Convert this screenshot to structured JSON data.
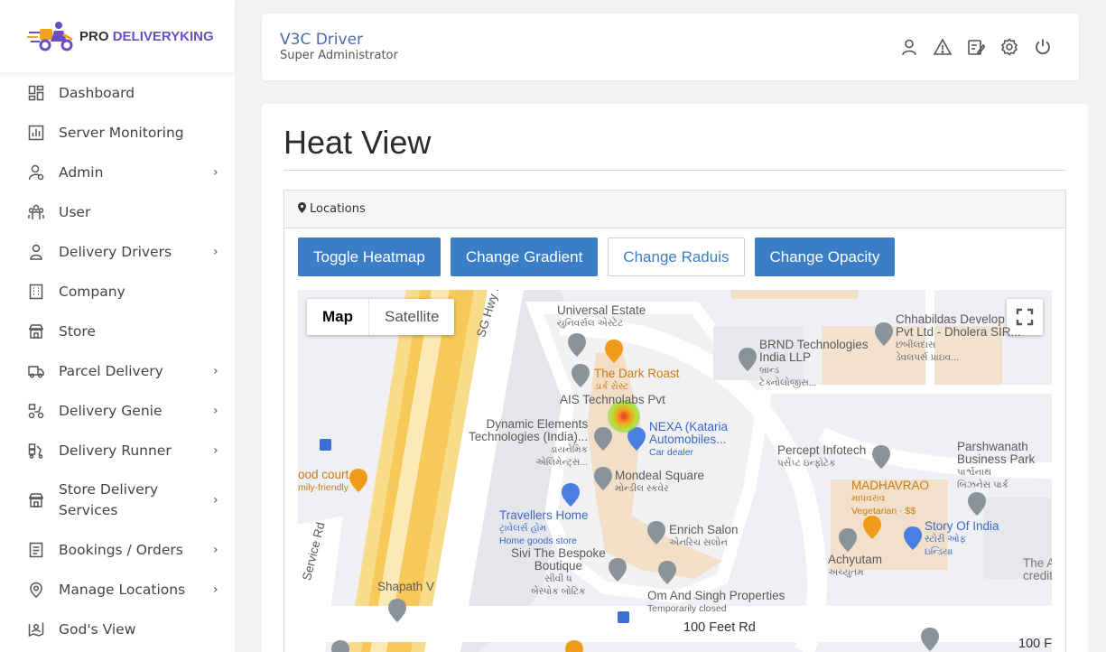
{
  "brand": {
    "pro": "PRO",
    "name": "DELIVERYKING"
  },
  "sidebar": {
    "items": [
      {
        "label": "Dashboard",
        "icon": "dashboard-icon",
        "chevron": false
      },
      {
        "label": "Server Monitoring",
        "icon": "chart-icon",
        "chevron": false
      },
      {
        "label": "Admin",
        "icon": "admin-icon",
        "chevron": true
      },
      {
        "label": "User",
        "icon": "users-icon",
        "chevron": false
      },
      {
        "label": "Delivery Drivers",
        "icon": "driver-icon",
        "chevron": true
      },
      {
        "label": "Company",
        "icon": "building-icon",
        "chevron": false
      },
      {
        "label": "Store",
        "icon": "store-icon",
        "chevron": false
      },
      {
        "label": "Parcel Delivery",
        "icon": "truck-icon",
        "chevron": true
      },
      {
        "label": "Delivery Genie",
        "icon": "scooter-icon",
        "chevron": true
      },
      {
        "label": "Delivery Runner",
        "icon": "runner-icon",
        "chevron": true
      },
      {
        "label": "Store Delivery Services",
        "icon": "store-icon",
        "chevron": true
      },
      {
        "label": "Bookings / Orders",
        "icon": "list-icon",
        "chevron": true
      },
      {
        "label": "Manage Locations",
        "icon": "location-icon",
        "chevron": true
      },
      {
        "label": "God's View",
        "icon": "map-user-icon",
        "chevron": false
      }
    ],
    "chevron_glyph": "›"
  },
  "header": {
    "title": "V3C Driver",
    "subtitle": "Super Administrator",
    "icons": [
      "user-icon",
      "warning-icon",
      "edit-icon",
      "settings-icon",
      "power-icon"
    ]
  },
  "main": {
    "title": "Heat View",
    "panel_title": "Locations",
    "buttons": {
      "toggle": "Toggle Heatmap",
      "gradient": "Change Gradient",
      "radius": "Change Raduis",
      "opacity": "Change Opacity"
    }
  },
  "map": {
    "type_map": "Map",
    "type_satellite": "Satellite",
    "labels": {
      "universal_estate": "Universal Estate",
      "universal_estate_gu": "યુનિવર્સલ એસ્ટેટ",
      "dark_roast": "The Dark Roast",
      "dark_roast_gu": "ડાર્ક રોસ્ટ",
      "ais": "AIS Technolabs Pvt",
      "dynamic1": "Dynamic Elements",
      "dynamic2": "Technologies (India)...",
      "dynamic_gu1": "ડાયનેમિક",
      "dynamic_gu2": "એલિમેન્ટ્સ...",
      "nexa1": "NEXA (Kataria",
      "nexa2": "Automobiles...",
      "nexa_sub": "Car dealer",
      "mondeal": "Mondeal Square",
      "mondeal_gu": "મોન્ડીલ સ્કવેર",
      "travellers": "Travellers Home",
      "travellers_gu": "ટ્રાવેલર્સ હોમ",
      "travellers_sub": "Home goods store",
      "enrich": "Enrich Salon",
      "enrich_gu": "એનરિચ સલોન",
      "sivi1": "Sivi The Bespoke",
      "sivi2": "Boutique",
      "sivi_gu1": "સીવી ધ",
      "sivi_gu2": "બેસ્પોક બોટિક",
      "om": "Om And Singh Properties",
      "om_sub": "Temporarily closed",
      "shapath": "Shapath V",
      "road_100": "100 Feet Rd",
      "road_100b": "100 F",
      "sg_hwy": "SG Hwy Service R",
      "service_rd": "Service Rd",
      "food_court1": "ood court",
      "food_court2": "mily-friendly",
      "brnd1": "BRND Technologies",
      "brnd2": "India LLP",
      "brnd_gu1": "બ્રાન્ડ",
      "brnd_gu2": "ટેક્નોલોજીસ...",
      "chhabil1": "Chhabildas Develop",
      "chhabil2": "Pvt Ltd - Dholera SIR...",
      "chhabil_gu1": "છબીલદાસ",
      "chhabil_gu2": "ડેવલપર્સ પ્રાઇવ...",
      "percept": "Percept Infotech",
      "percept_gu": "પર્સેપ્ટ ઇન્ફોટેક",
      "parsh1": "Parshwanath",
      "parsh2": "Business Park",
      "parsh_gu1": "પાર્શ્વનાથ",
      "parsh_gu2": "બિઝનેસ પાર્ક",
      "madhav": "MADHAVRAO",
      "madhav_gu": "માધવરાવ",
      "madhav_sub": "Vegetarian · $$",
      "story1": "Story Of India",
      "story_gu": "સ્ટોરી ઓફ",
      "story_gu2": "ઇન્ડિયા",
      "achyutam": "Achyutam",
      "achyutam_gu": "અચ્યુતમ",
      "the_a": "The A",
      "credit": "credit"
    }
  }
}
